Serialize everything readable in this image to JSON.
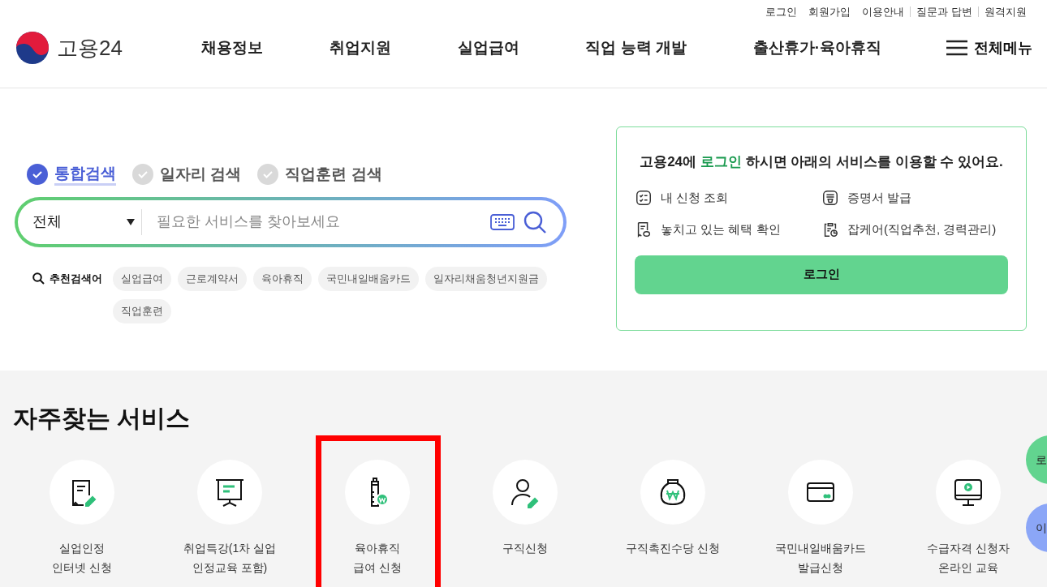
{
  "top_links": [
    "로그인",
    "회원가입",
    "이용안내",
    "질문과 답변",
    "원격지원"
  ],
  "logo": {
    "text": "고용24"
  },
  "nav": [
    "채용정보",
    "취업지원",
    "실업급여",
    "직업 능력 개발",
    "출산휴가·육아휴직"
  ],
  "all_menu": "전체메뉴",
  "search_tabs": [
    {
      "label": "통합검색",
      "selected": true
    },
    {
      "label": "일자리 검색",
      "selected": false
    },
    {
      "label": "직업훈련 검색",
      "selected": false
    }
  ],
  "search": {
    "scope": "전체",
    "placeholder": "필요한 서비스를 찾아보세요"
  },
  "recommended": {
    "label": "추천검색어",
    "tags": [
      "실업급여",
      "근로계약서",
      "육아휴직",
      "국민내일배움카드",
      "일자리채움청년지원금",
      "직업훈련"
    ]
  },
  "login_card": {
    "message": "고용24에 **로그인** 하시면 아래의 서비스를 이용할 수 있어요.",
    "features": [
      {
        "kind": "checklist",
        "label": "내 신청 조회"
      },
      {
        "kind": "certificate",
        "label": "증명서 발급"
      },
      {
        "kind": "receipt",
        "label": "놓치고 있는 혜택 확인"
      },
      {
        "kind": "clipboard",
        "label": "잡케어(직업추천, 경력관리)"
      }
    ],
    "button": "로그인"
  },
  "services": {
    "title": "자주찾는 서비스",
    "items": [
      {
        "kind": "document",
        "label": [
          "실업인정",
          "인터넷 신청"
        ],
        "highlighted": false
      },
      {
        "kind": "presentation",
        "label": [
          "취업특강(1차 실업",
          "인정교육 포함)"
        ],
        "highlighted": false
      },
      {
        "kind": "bottle",
        "label": [
          "육아휴직",
          "급여 신청"
        ],
        "highlighted": true
      },
      {
        "kind": "person",
        "label": [
          "구직신청"
        ],
        "highlighted": false
      },
      {
        "kind": "moneybag",
        "label": [
          "구직촉진수당 신청"
        ],
        "highlighted": false
      },
      {
        "kind": "card",
        "label": [
          "국민내일배움카드",
          "발급신청"
        ],
        "highlighted": false
      },
      {
        "kind": "monitor",
        "label": [
          "수급자격 신청자",
          "온라인 교육"
        ],
        "highlighted": false
      }
    ]
  },
  "floating_buttons": [
    {
      "text": "로",
      "color": "#62d48f"
    },
    {
      "text": "이",
      "color": "#8ba6f7"
    }
  ]
}
